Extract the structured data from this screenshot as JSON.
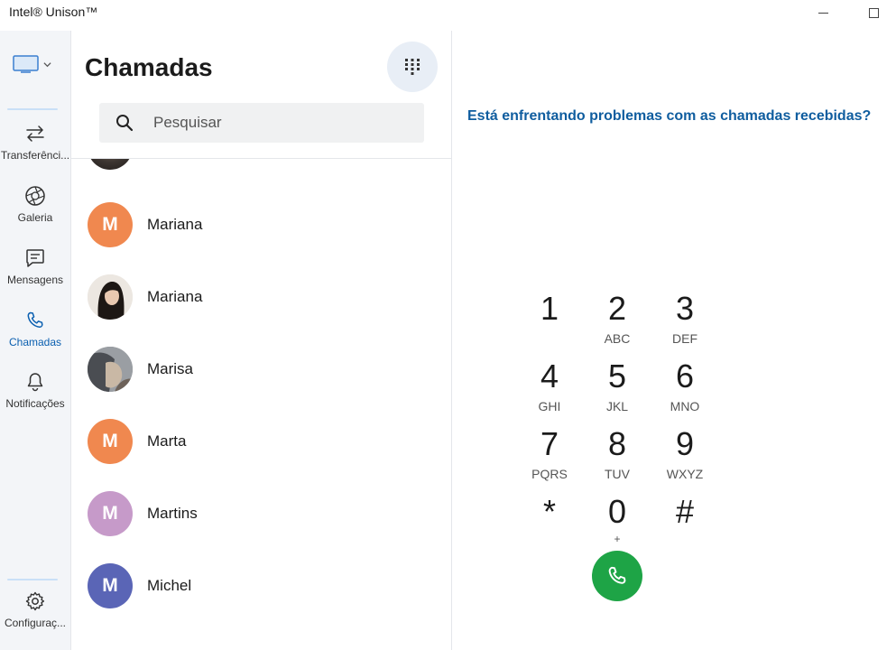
{
  "app": {
    "title": "Intel® Unison™"
  },
  "rail": {
    "items": [
      {
        "label": "Transferênci..."
      },
      {
        "label": "Galeria"
      },
      {
        "label": "Mensagens"
      },
      {
        "label": "Chamadas"
      },
      {
        "label": "Notificações"
      }
    ],
    "settings_label": "Configuraç..."
  },
  "calls": {
    "title": "Chamadas",
    "search_placeholder": "Pesquisar",
    "contacts": [
      {
        "name": "",
        "initial": "",
        "avatar": "photo"
      },
      {
        "name": "Mariana",
        "initial": "M",
        "avatar_color": "#f0884f"
      },
      {
        "name": "Mariana",
        "initial": "",
        "avatar": "photo"
      },
      {
        "name": "Marisa",
        "initial": "",
        "avatar": "photo"
      },
      {
        "name": "Marta",
        "initial": "M",
        "avatar_color": "#f0884f"
      },
      {
        "name": "Martins",
        "initial": "M",
        "avatar_color": "#c69ac9"
      },
      {
        "name": "Michel",
        "initial": "M",
        "avatar_color": "#5a65b6"
      }
    ]
  },
  "dialer": {
    "help_text": "Está enfrentando problemas com as chamadas recebidas?",
    "keys": [
      {
        "digit": "1",
        "letters": ""
      },
      {
        "digit": "2",
        "letters": "ABC"
      },
      {
        "digit": "3",
        "letters": "DEF"
      },
      {
        "digit": "4",
        "letters": "GHI"
      },
      {
        "digit": "5",
        "letters": "JKL"
      },
      {
        "digit": "6",
        "letters": "MNO"
      },
      {
        "digit": "7",
        "letters": "PQRS"
      },
      {
        "digit": "8",
        "letters": "TUV"
      },
      {
        "digit": "9",
        "letters": "WXYZ"
      },
      {
        "digit": "*",
        "letters": ""
      },
      {
        "digit": "0",
        "letters": "+"
      },
      {
        "digit": "#",
        "letters": ""
      }
    ]
  },
  "colors": {
    "accent": "#0a5fb0",
    "call_green": "#1ea446",
    "link": "#0f5d9f"
  }
}
